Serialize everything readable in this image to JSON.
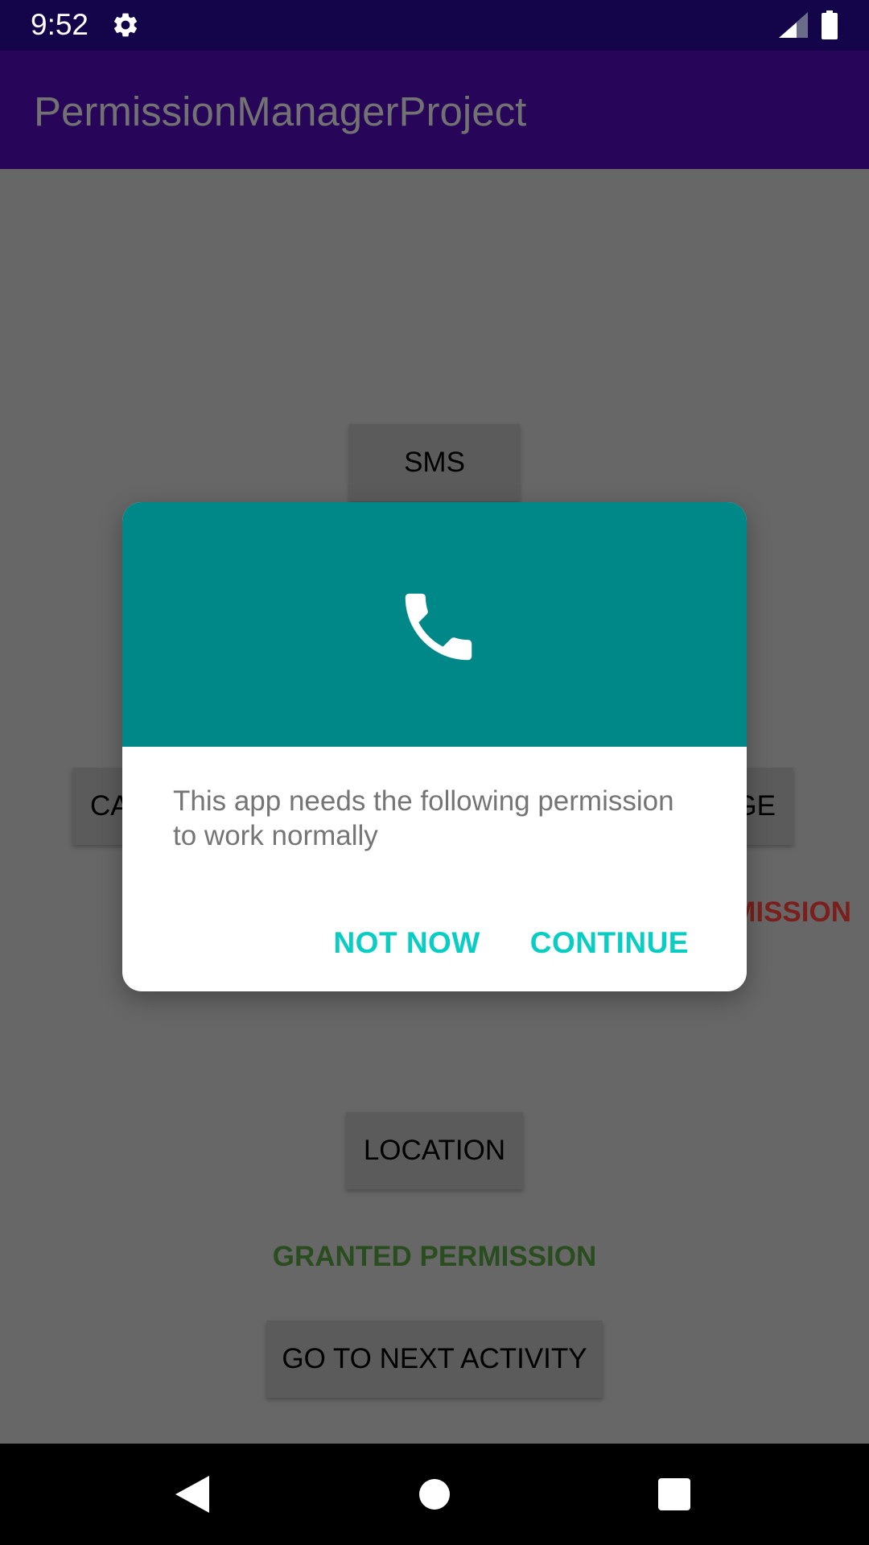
{
  "status_bar": {
    "time": "9:52",
    "icons": [
      "gear-icon",
      "cellular-signal-icon",
      "battery-icon"
    ]
  },
  "app_bar": {
    "title": "PermissionManagerProject"
  },
  "background": {
    "sms_button": "SMS",
    "left_button_partial": "CA",
    "right_button_partial": "GE",
    "denied_status_partial": "MISSION",
    "location_button": "LOCATION",
    "granted_status": "GRANTED PERMISSION",
    "next_activity_button": "GO TO NEXT ACTIVITY"
  },
  "dialog": {
    "icon": "phone-icon",
    "message": "This app needs the following permission to work normally",
    "not_now_label": "NOT NOW",
    "continue_label": "CONTINUE"
  },
  "nav_bar": {
    "icons": [
      "back-icon",
      "home-icon",
      "recents-icon"
    ]
  },
  "colors": {
    "status_bar": "#14054a",
    "app_bar": "#270659",
    "dialog_header": "#008888",
    "dialog_action": "#08cdc3",
    "granted": "#2a4d20",
    "denied": "#7a1f1b"
  }
}
